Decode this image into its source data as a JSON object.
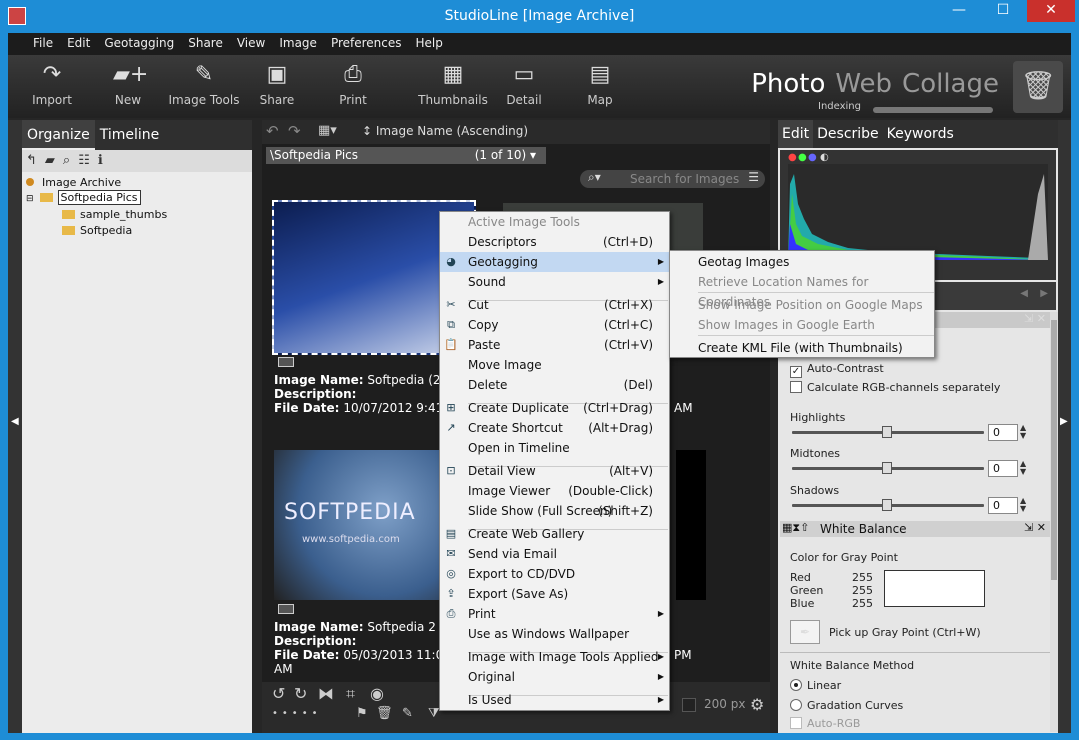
{
  "window": {
    "title": "StudioLine [Image Archive]",
    "minimize": "—",
    "maximize": "☐",
    "close": "✕"
  },
  "menubar": [
    "File",
    "Edit",
    "Geotagging",
    "Share",
    "View",
    "Image",
    "Preferences",
    "Help"
  ],
  "toolbar": {
    "tools": [
      {
        "label": "Import",
        "icon": "import-arrow-icon",
        "glyph": "↷"
      },
      {
        "label": "New",
        "icon": "new-folder-icon",
        "glyph": "▰+"
      },
      {
        "label": "Image Tools",
        "icon": "pen-tool-icon",
        "glyph": "✎"
      },
      {
        "label": "Share",
        "icon": "share-icon",
        "glyph": "▣"
      },
      {
        "label": "Print",
        "icon": "printer-icon",
        "glyph": "⎙"
      },
      {
        "label": "Thumbnails",
        "icon": "thumbnails-grid-icon",
        "glyph": "▦"
      },
      {
        "label": "Detail",
        "icon": "detail-view-icon",
        "glyph": "▭"
      },
      {
        "label": "Map",
        "icon": "map-icon",
        "glyph": "▤"
      }
    ],
    "modes": [
      "Photo",
      "Web",
      "Collage"
    ],
    "indexing": "Indexing",
    "trash_icon": "trash-bin-icon"
  },
  "left_panel": {
    "tabs": [
      "Organize",
      "Timeline"
    ],
    "tree": {
      "root": "Image Archive",
      "selected": "Softpedia Pics",
      "children": [
        "sample_thumbs",
        "Softpedia"
      ]
    }
  },
  "center": {
    "sort_label": "Image Name (Ascending)",
    "path": "\\Softpedia Pics",
    "count": "(1 of 10)",
    "search_placeholder": "Search for Images",
    "images": [
      {
        "name_label": "Image Name:",
        "name": "Softpedia (2)",
        "desc_label": "Description:",
        "date_label": "File Date:",
        "date": "10/07/2012 9:41:05",
        "date_tail": "AM"
      },
      {
        "name_label": "Image Name:",
        "name": "Softpedia 2",
        "desc_label": "Description:",
        "date_label": "File Date:",
        "date": "05/03/2013 11:06:1",
        "date_tail": "AM",
        "date_tail2": "PM"
      }
    ],
    "thumb_text": "SOFTPEDIA",
    "thumb_url": "www.softpedia.com",
    "zoom": "200 px"
  },
  "context_menu": {
    "items": [
      {
        "label": "Active Image Tools",
        "disabled": true
      },
      {
        "label": "Descriptors",
        "shortcut": "(Ctrl+D)"
      },
      {
        "label": "Geotagging",
        "icon": "globe-icon",
        "submenu": true,
        "highlight": true
      },
      {
        "label": "Sound",
        "submenu": true
      },
      {
        "label": "Cut",
        "shortcut": "(Ctrl+X)",
        "icon": "scissors-icon"
      },
      {
        "label": "Copy",
        "shortcut": "(Ctrl+C)",
        "icon": "copy-icon"
      },
      {
        "label": "Paste",
        "shortcut": "(Ctrl+V)",
        "icon": "paste-icon"
      },
      {
        "label": "Move Image"
      },
      {
        "label": "Delete",
        "shortcut": "(Del)"
      },
      {
        "label": "Create Duplicate",
        "shortcut": "(Ctrl+Drag)",
        "icon": "duplicate-icon"
      },
      {
        "label": "Create Shortcut",
        "shortcut": "(Alt+Drag)",
        "icon": "shortcut-icon"
      },
      {
        "label": "Open in Timeline"
      },
      {
        "label": "Detail View",
        "shortcut": "(Alt+V)",
        "icon": "detail-view-icon"
      },
      {
        "label": "Image Viewer",
        "shortcut": "(Double-Click)"
      },
      {
        "label": "Slide Show (Full Screen)",
        "shortcut": "(Shift+Z)"
      },
      {
        "label": "Create Web Gallery",
        "icon": "web-gallery-icon"
      },
      {
        "label": "Send via Email",
        "icon": "email-icon"
      },
      {
        "label": "Export to CD/DVD",
        "icon": "disc-icon"
      },
      {
        "label": "Export (Save As)",
        "icon": "export-icon"
      },
      {
        "label": "Print",
        "icon": "printer-icon",
        "submenu": true
      },
      {
        "label": "Use as Windows Wallpaper"
      },
      {
        "label": "Image with Image Tools Applied",
        "submenu": true
      },
      {
        "label": "Original",
        "submenu": true
      },
      {
        "label": "Is Used",
        "submenu": true
      }
    ]
  },
  "submenu": {
    "items": [
      {
        "label": "Geotag Images"
      },
      {
        "label": "Retrieve Location Names for Coordinates",
        "disabled": true
      },
      {
        "label": "Show Image Position on Google Maps",
        "disabled": true
      },
      {
        "label": "Show Images in Google Earth",
        "disabled": true
      },
      {
        "label": "Create KML File (with Thumbnails)"
      }
    ]
  },
  "right_panel": {
    "tabs": [
      "Edit",
      "Describe",
      "Keywords"
    ],
    "auto_contrast": "Auto-Contrast",
    "rgb_separate": "Calculate RGB-channels separately",
    "highlights": "Highlights",
    "midtones": "Midtones",
    "shadows": "Shadows",
    "highlights_value": "0",
    "midtones_value": "0",
    "shadows_value": "0",
    "white_balance": "White Balance",
    "gray_point": "Color for Gray Point",
    "red_label": "Red",
    "red": "255",
    "green_label": "Green",
    "green": "255",
    "blue_label": "Blue",
    "blue": "255",
    "pick_gray": "Pick up Gray Point (Ctrl+W)",
    "wb_method": "White Balance Method",
    "linear": "Linear",
    "gradation": "Gradation Curves",
    "auto_rgb": "Auto-RGB"
  }
}
